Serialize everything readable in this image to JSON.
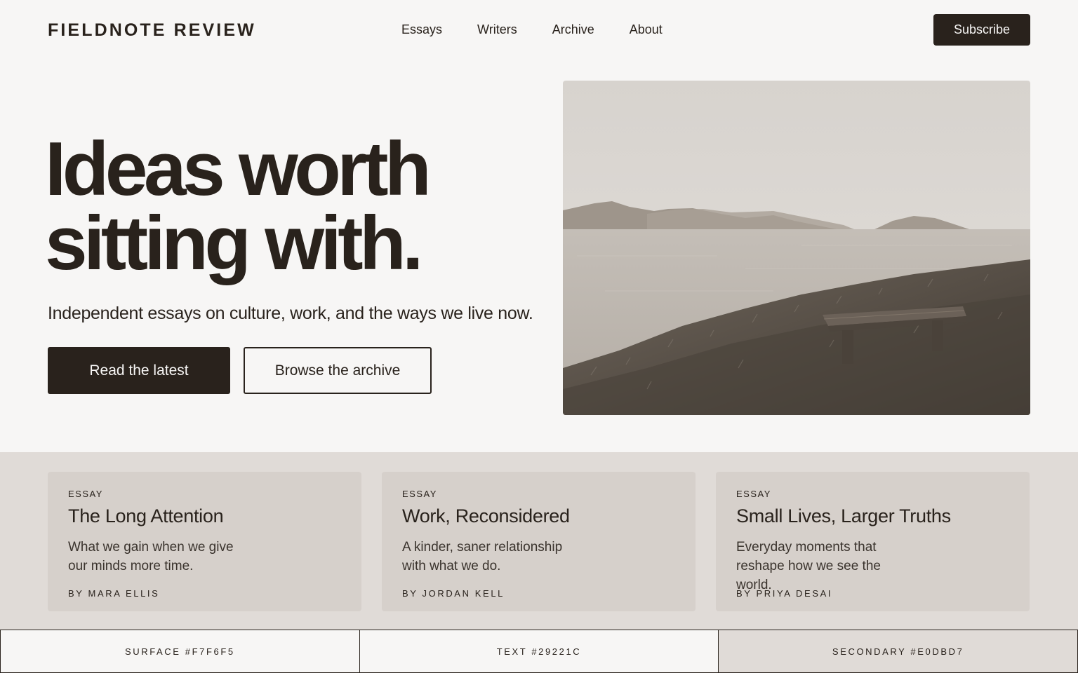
{
  "brand": {
    "name": "FIELDNOTE REVIEW"
  },
  "nav": {
    "items": [
      "Essays",
      "Writers",
      "Archive",
      "About"
    ]
  },
  "header": {
    "subscribe_label": "Subscribe"
  },
  "hero": {
    "headline_line1": "Ideas worth",
    "headline_line2": "sitting with.",
    "subline": "Independent essays on culture, work, and the ways we live now.",
    "primary_cta": "Read the latest",
    "secondary_cta": "Browse the archive",
    "image": "coastal-landscape-with-bench"
  },
  "cards": [
    {
      "kicker": "ESSAY",
      "title": "The Long Attention",
      "desc_line1": "What we gain when we give",
      "desc_line2": "our minds more time.",
      "byline": "BY MARA ELLIS"
    },
    {
      "kicker": "ESSAY",
      "title": "Work, Reconsidered",
      "desc_line1": "A kinder, saner relationship",
      "desc_line2": "with what we do.",
      "byline": "BY JORDAN KELL"
    },
    {
      "kicker": "ESSAY",
      "title": "Small Lives, Larger Truths",
      "desc_line1": "Everyday moments that",
      "desc_line2": "reshape how we see the world.",
      "byline": "BY PRIYA DESAI"
    }
  ],
  "swatches": [
    {
      "label": "SURFACE  #F7F6F5",
      "color": "#F7F6F5"
    },
    {
      "label": "TEXT  #29221C",
      "color": "#29221C"
    },
    {
      "label": "SECONDARY  #E0DBD7",
      "color": "#E0DBD7"
    }
  ],
  "colors": {
    "surface": "#f7f6f5",
    "text": "#29221c",
    "secondary": "#e0dbd7"
  }
}
